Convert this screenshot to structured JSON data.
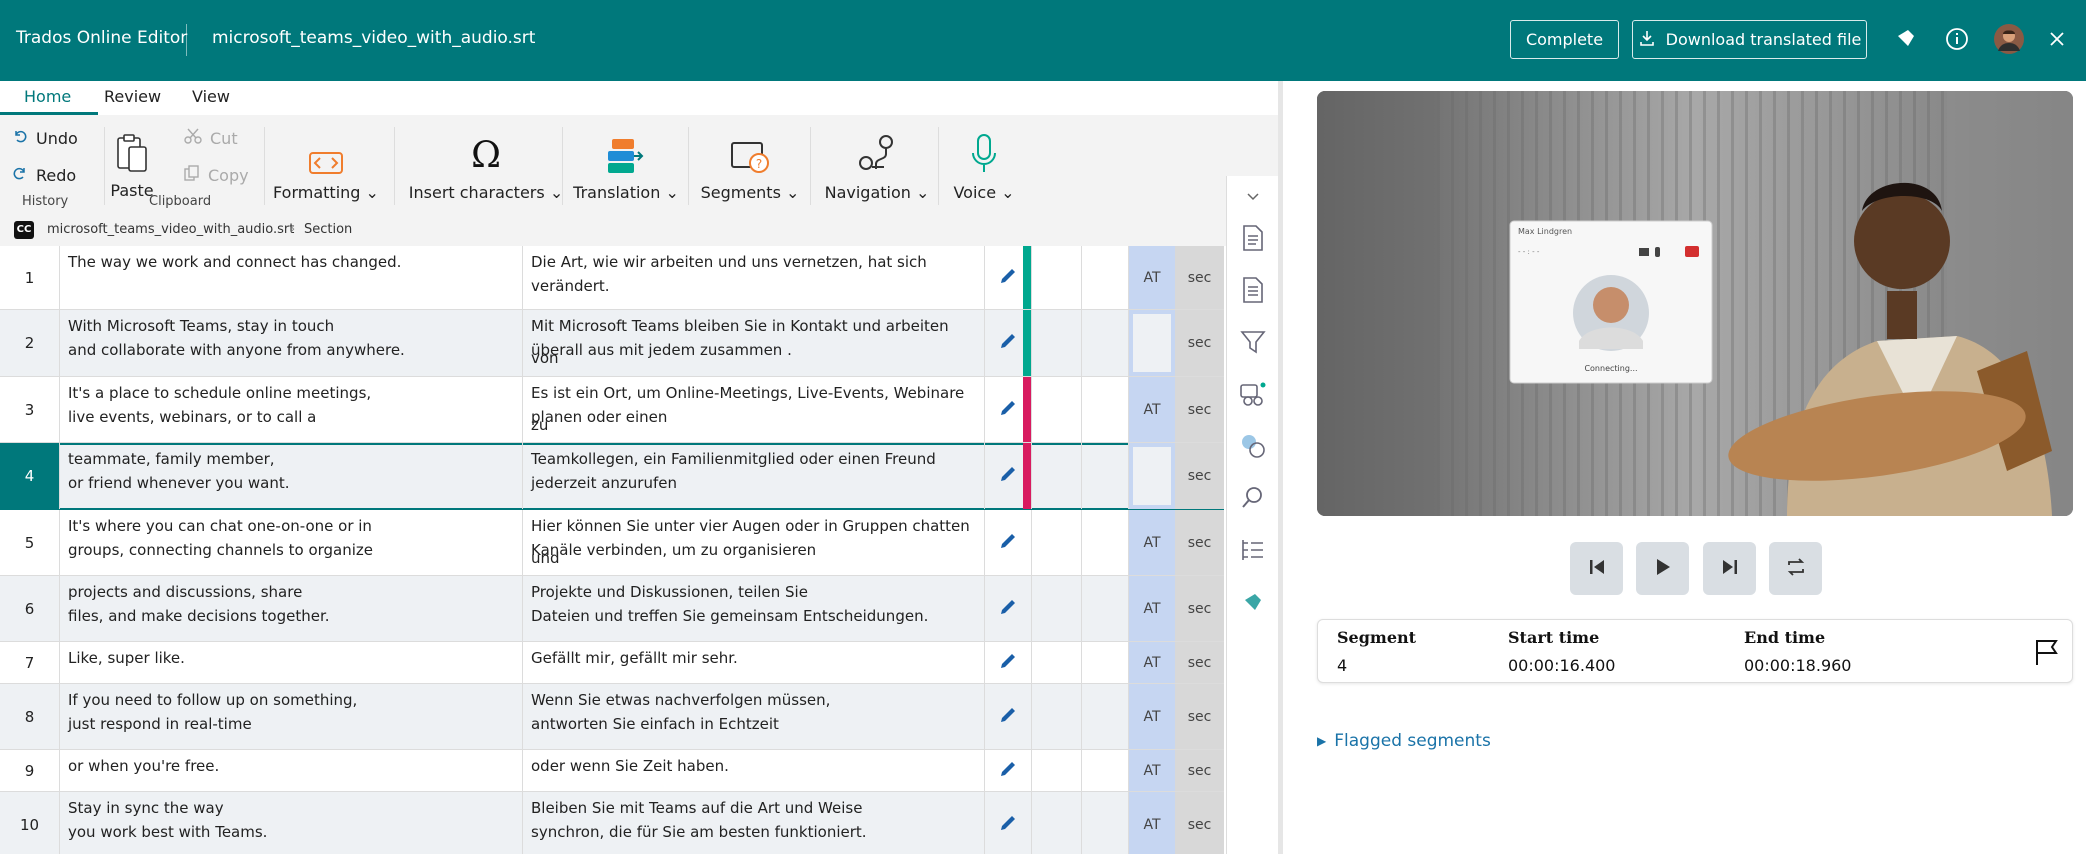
{
  "app": {
    "title": "Trados Online Editor",
    "file_name": "microsoft_teams_video_with_audio.srt",
    "complete_label": "Complete",
    "download_label": "Download translated file",
    "brand_color": "#00787b"
  },
  "ribbon_tabs": [
    "Home",
    "Review",
    "View"
  ],
  "ribbon": {
    "undo": "Undo",
    "redo": "Redo",
    "history_group": "History",
    "paste": "Paste",
    "cut": "Cut",
    "copy": "Copy",
    "clipboard_group": "Clipboard",
    "formatting": "Formatting",
    "insert_characters": "Insert characters",
    "translation": "Translation",
    "segments": "Segments",
    "navigation": "Navigation",
    "voice": "Voice"
  },
  "breadcrumb": {
    "file": "microsoft_teams_video_with_audio.srt",
    "section": "Section"
  },
  "segments": [
    {
      "num": "1",
      "src": [
        "The way we work and connect has changed."
      ],
      "tgt": [
        "Die Art, wie wir arbeiten und uns vernetzen, hat sich",
        "verändert."
      ],
      "status": "AT",
      "unit": "sec",
      "bar": "#00a88f"
    },
    {
      "num": "2",
      "src": [
        "With Microsoft Teams, stay in touch",
        "and collaborate with anyone from anywhere."
      ],
      "tgt": [
        "Mit Microsoft Teams bleiben Sie in Kontakt und arbeiten von",
        "überall aus mit jedem zusammen ."
      ],
      "status": "",
      "unit": "sec",
      "bar": "#00a88f"
    },
    {
      "num": "3",
      "src": [
        "It's a place to schedule online meetings,",
        "live events, webinars, or to call a"
      ],
      "tgt": [
        "Es ist ein Ort, um Online-Meetings, Live-Events, Webinare zu",
        "planen oder einen"
      ],
      "status": "AT",
      "unit": "sec",
      "bar": "#d81b60"
    },
    {
      "num": "4",
      "src": [
        "teammate, family member,",
        "or friend whenever you want."
      ],
      "tgt": [
        "Teamkollegen, ein Familienmitglied oder einen Freund",
        "jederzeit anzurufen"
      ],
      "status": "",
      "unit": "sec",
      "bar": "#d81b60"
    },
    {
      "num": "5",
      "src": [
        "It's where you can chat one-on-one or in",
        "groups, connecting channels to organize"
      ],
      "tgt": [
        "Hier können Sie unter vier Augen oder in Gruppen chatten und",
        "Kanäle verbinden, um zu organisieren"
      ],
      "status": "AT",
      "unit": "sec",
      "bar": ""
    },
    {
      "num": "6",
      "src": [
        "projects and discussions, share",
        "files, and make decisions together."
      ],
      "tgt": [
        "Projekte und Diskussionen, teilen Sie",
        "Dateien und treffen Sie gemeinsam Entscheidungen."
      ],
      "status": "AT",
      "unit": "sec",
      "bar": ""
    },
    {
      "num": "7",
      "src": [
        "Like, super like."
      ],
      "tgt": [
        "Gefällt mir, gefällt mir sehr."
      ],
      "status": "AT",
      "unit": "sec",
      "bar": ""
    },
    {
      "num": "8",
      "src": [
        "If you need to follow up on something,",
        "just respond in real-time"
      ],
      "tgt": [
        "Wenn Sie etwas nachverfolgen müssen,",
        "antworten Sie einfach in Echtzeit"
      ],
      "status": "AT",
      "unit": "sec",
      "bar": ""
    },
    {
      "num": "9",
      "src": [
        "or when you're free."
      ],
      "tgt": [
        "oder wenn Sie Zeit haben."
      ],
      "status": "AT",
      "unit": "sec",
      "bar": ""
    },
    {
      "num": "10",
      "src": [
        "Stay in sync the way",
        "you work best with Teams."
      ],
      "tgt": [
        "Bleiben Sie mit Teams auf die Art und Weise",
        "synchron, die für Sie am besten funktioniert."
      ],
      "status": "AT",
      "unit": "sec",
      "bar": ""
    }
  ],
  "video": {
    "call_name": "Max Lindgren",
    "call_status": "Connecting...",
    "call_timer": "- - : - -"
  },
  "segment_info": {
    "segment_header": "Segment",
    "start_header": "Start time",
    "end_header": "End time",
    "segment": "4",
    "start": "00:00:16.400",
    "end": "00:00:18.960"
  },
  "flagged_label": "Flagged segments"
}
